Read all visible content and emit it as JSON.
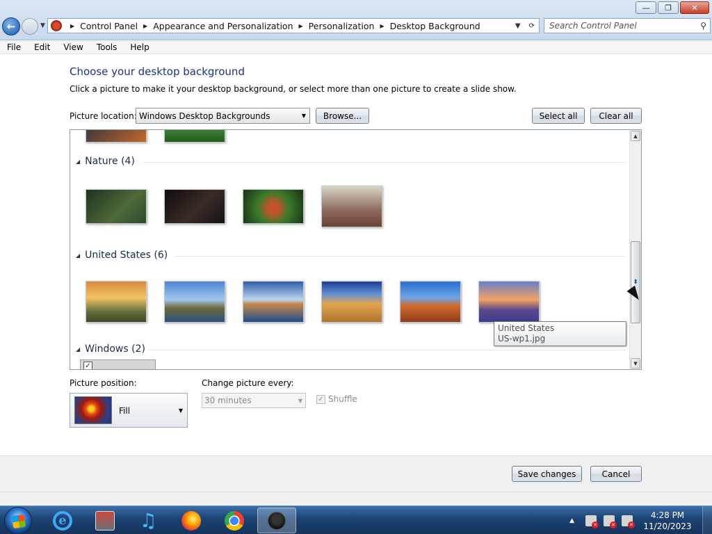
{
  "window": {
    "minimize": "—",
    "maximize": "❐",
    "close": "✕"
  },
  "breadcrumb": [
    "Control Panel",
    "Appearance and Personalization",
    "Personalization",
    "Desktop Background"
  ],
  "search": {
    "placeholder": "Search Control Panel"
  },
  "menu": [
    "File",
    "Edit",
    "View",
    "Tools",
    "Help"
  ],
  "page": {
    "title": "Choose your desktop background",
    "description": "Click a picture to make it your desktop background, or select more than one picture to create a slide show."
  },
  "location": {
    "label": "Picture location:",
    "value": "Windows Desktop Backgrounds",
    "browse": "Browse...",
    "select_all": "Select all",
    "clear_all": "Clear all"
  },
  "groups": [
    {
      "name": "Nature (4)",
      "thumbs": [
        "#2b4a2a",
        "#1a1a1c",
        "#3d7a2a",
        "#8c6a5a"
      ]
    },
    {
      "name": "United States (6)",
      "thumbs": [
        "#c77a3a",
        "#3b6fb8",
        "#2e5fa8",
        "#c9873e",
        "#d26b2f",
        "#7c5fa1"
      ]
    },
    {
      "name": "Windows (2)",
      "thumbs": []
    }
  ],
  "tooltip": {
    "line1": "United States",
    "line2": "US-wp1.jpg"
  },
  "position": {
    "label": "Picture position:",
    "value": "Fill"
  },
  "change": {
    "label": "Change picture every:",
    "value": "30 minutes"
  },
  "shuffle": {
    "label": "Shuffle",
    "checked": true
  },
  "actions": {
    "save": "Save changes",
    "cancel": "Cancel"
  },
  "taskbar": {
    "time": "4:28 PM",
    "date": "11/20/2023"
  }
}
